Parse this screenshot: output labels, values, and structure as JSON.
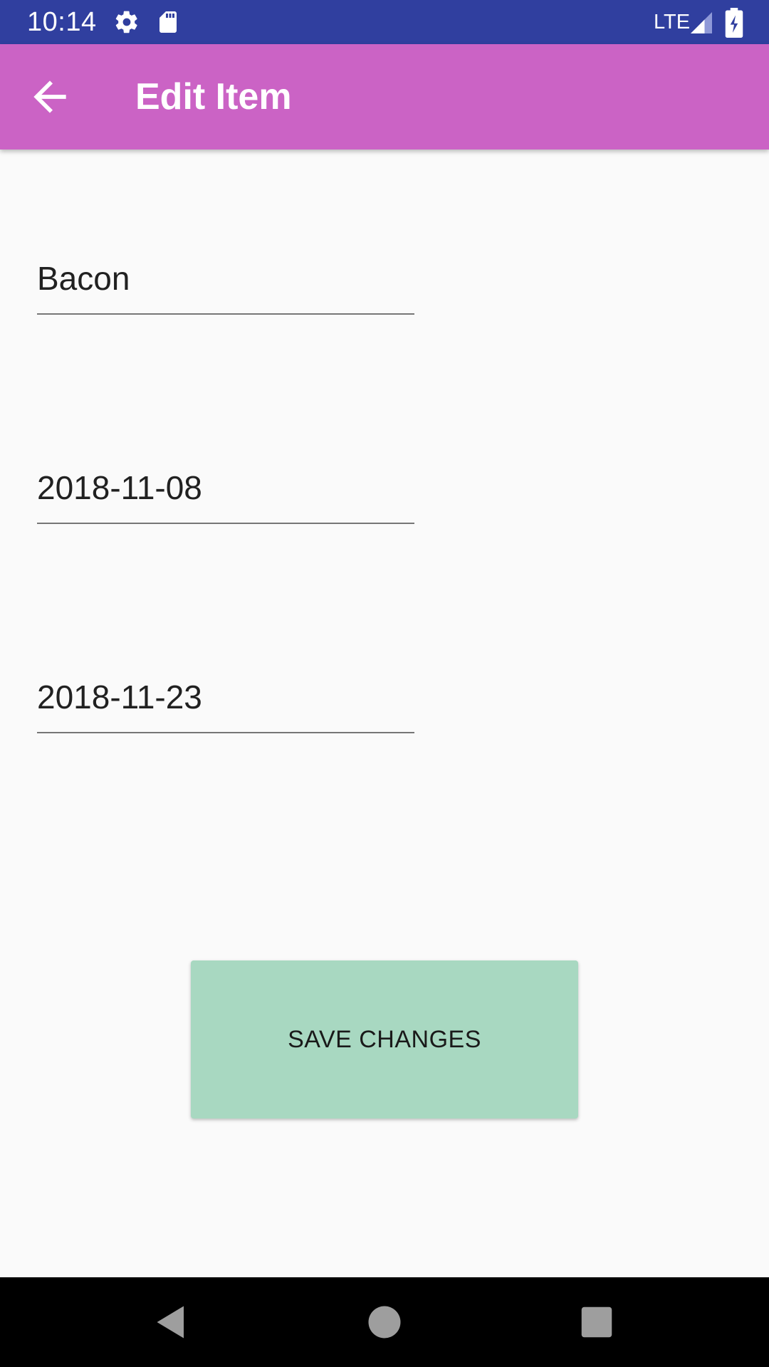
{
  "status_bar": {
    "time": "10:14",
    "network": "LTE",
    "icons": [
      "settings-icon",
      "sd-card-icon",
      "signal-icon",
      "battery-charging-icon"
    ],
    "background": "#303f9f"
  },
  "app_bar": {
    "title": "Edit Item",
    "back_icon": "arrow-back-icon",
    "background": "#cb63c5"
  },
  "form": {
    "item_name": "Bacon",
    "start_date": "2018-11-08",
    "end_date": "2018-11-23"
  },
  "save_button": {
    "label": "SAVE CHANGES",
    "background": "#a8d8c1"
  },
  "nav_bar": {
    "icons": [
      "back-triangle-icon",
      "home-circle-icon",
      "recents-square-icon"
    ]
  }
}
